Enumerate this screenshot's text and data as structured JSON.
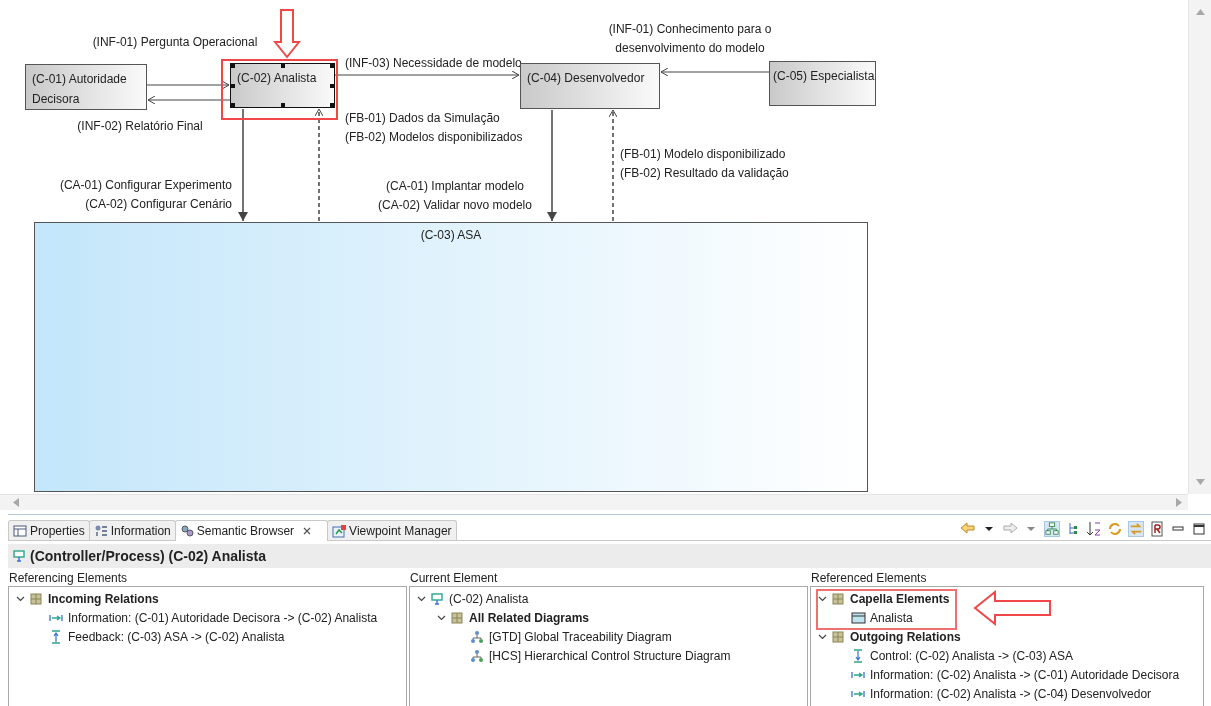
{
  "diagram": {
    "nodes": [
      {
        "label": "(C-01) Autoridade Decisora",
        "kind": "controller",
        "selected": false
      },
      {
        "label": "(C-02) Analista",
        "kind": "controller",
        "selected": true
      },
      {
        "label": "(C-04) Desenvolvedor",
        "kind": "controller",
        "selected": false
      },
      {
        "label": "(C-05) Especialista",
        "kind": "controller",
        "selected": false
      },
      {
        "label": "(C-03) ASA",
        "kind": "process",
        "selected": false
      }
    ],
    "edges": [
      {
        "kind": "information",
        "labels": [
          "(INF-01) Pergunta Operacional"
        ]
      },
      {
        "kind": "information",
        "labels": [
          "(INF-02) Relatório Final"
        ]
      },
      {
        "kind": "information",
        "labels": [
          "(INF-03) Necessidade de modelo"
        ]
      },
      {
        "kind": "information",
        "labels": [
          "(INF-01) Conhecimento para o",
          "desenvolvimento do modelo"
        ]
      },
      {
        "kind": "control",
        "labels": [
          "(CA-01) Configurar Experimento",
          "(CA-02) Configurar Cenário"
        ]
      },
      {
        "kind": "feedback",
        "labels": [
          "(FB-01) Dados da Simulação",
          "(FB-02) Modelos disponibilizados"
        ]
      },
      {
        "kind": "control",
        "labels": [
          "(CA-01) Implantar modelo",
          "(CA-02) Validar novo modelo"
        ]
      },
      {
        "kind": "feedback",
        "labels": [
          "(FB-01) Modelo disponibilizado",
          "(FB-02) Resultado da validação"
        ]
      }
    ]
  },
  "tabs": [
    {
      "label": "Properties",
      "selected": false
    },
    {
      "label": "Information",
      "selected": false
    },
    {
      "label": "Semantic Browser",
      "selected": true
    },
    {
      "label": "Viewpoint Manager",
      "selected": false
    }
  ],
  "browser": {
    "title": "(Controller/Process) (C-02) Analista",
    "panes": [
      {
        "heading": "Referencing Elements",
        "items": [
          {
            "label": "Incoming Relations",
            "kind": "group",
            "expanded": true,
            "children": [
              {
                "label": "Information: (C-01) Autoridade Decisora -> (C-02) Analista",
                "kind": "information"
              },
              {
                "label": "Feedback: (C-03) ASA -> (C-02) Analista",
                "kind": "feedback"
              }
            ]
          }
        ]
      },
      {
        "heading": "Current Element",
        "items": [
          {
            "label": "(C-02) Analista",
            "kind": "controller",
            "expanded": true,
            "children": [
              {
                "label": "All Related Diagrams",
                "kind": "group",
                "expanded": true,
                "children": [
                  {
                    "label": "[GTD] Global Traceability Diagram",
                    "kind": "diagram"
                  },
                  {
                    "label": "[HCS] Hierarchical Control Structure Diagram",
                    "kind": "diagram"
                  }
                ]
              }
            ]
          }
        ]
      },
      {
        "heading": "Referenced Elements",
        "items": [
          {
            "label": "Capella Elements",
            "kind": "group",
            "expanded": true,
            "children": [
              {
                "label": "Analista",
                "kind": "class"
              }
            ]
          },
          {
            "label": "Outgoing Relations",
            "kind": "group",
            "expanded": true,
            "children": [
              {
                "label": "Control: (C-02) Analista -> (C-03) ASA",
                "kind": "control"
              },
              {
                "label": "Information: (C-02) Analista -> (C-01) Autoridade Decisora",
                "kind": "information"
              },
              {
                "label": "Information: (C-02) Analista -> (C-04) Desenvolvedor",
                "kind": "information"
              }
            ]
          }
        ]
      }
    ]
  }
}
